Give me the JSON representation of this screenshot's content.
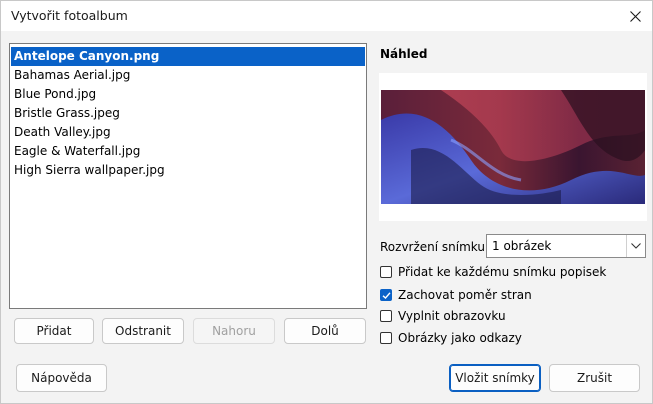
{
  "window": {
    "title": "Vytvořit fotoalbum"
  },
  "files": [
    "Antelope Canyon.png",
    "Bahamas Aerial.jpg",
    "Blue Pond.jpg",
    "Bristle Grass.jpeg",
    "Death Valley.jpg",
    "Eagle & Waterfall.jpg",
    "High Sierra wallpaper.jpg"
  ],
  "list_buttons": {
    "add": "Přidat",
    "remove": "Odstranit",
    "up": "Nahoru",
    "down": "Dolů"
  },
  "preview": {
    "label": "Náhled"
  },
  "layout": {
    "label": "Rozvržení snímku:",
    "value": "1 obrázek"
  },
  "options": {
    "caption": "Přidat ke každému snímku popisek",
    "keep_ratio": "Zachovat poměr stran",
    "fill": "Vyplnit obrazovku",
    "links": "Obrázky jako odkazy"
  },
  "footer": {
    "help": "Nápověda",
    "insert": "Vložit snímky",
    "cancel": "Zrušit"
  },
  "state": {
    "selected_file": "Antelope Canyon.png",
    "keep_ratio_checked": true,
    "caption_checked": false,
    "fill_checked": false,
    "links_checked": false,
    "up_disabled": true
  },
  "colors": {
    "accent": "#0a62c8"
  }
}
